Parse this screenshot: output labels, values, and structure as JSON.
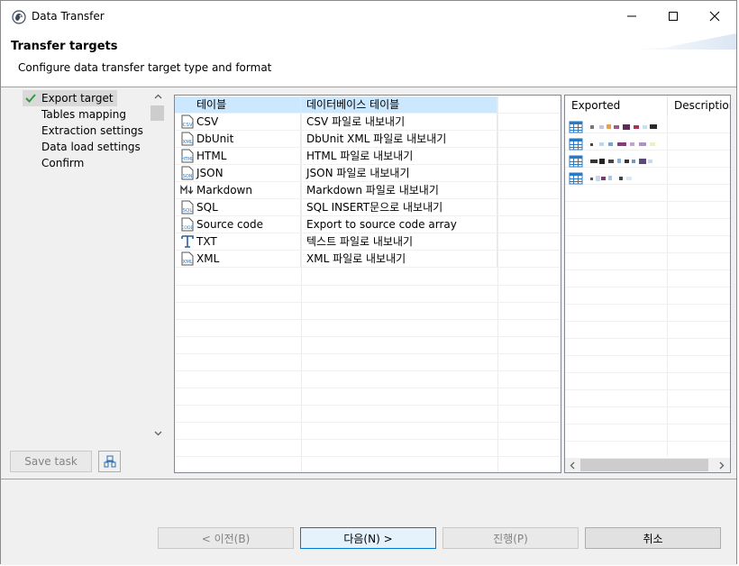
{
  "window": {
    "title": "Data Transfer",
    "accent": "#0078d7"
  },
  "header": {
    "title": "Transfer targets",
    "description": "Configure data transfer target type and format"
  },
  "nav": {
    "items": [
      {
        "label": "Export target",
        "selected": true,
        "icon": "check-icon"
      },
      {
        "label": "Tables mapping"
      },
      {
        "label": "Extraction settings"
      },
      {
        "label": "Data load settings"
      },
      {
        "label": "Confirm"
      }
    ],
    "save_task_label": "Save task"
  },
  "targets": [
    {
      "name": "테이블",
      "description": "데이터베이스 테이블",
      "icon": "table-icon",
      "selected": true
    },
    {
      "name": "CSV",
      "description": "CSV 파일로 내보내기",
      "icon": "csv-icon"
    },
    {
      "name": "DbUnit",
      "description": "DbUnit XML 파일로 내보내기",
      "icon": "xml-icon"
    },
    {
      "name": "HTML",
      "description": "HTML 파일로 내보내기",
      "icon": "html-icon"
    },
    {
      "name": "JSON",
      "description": "JSON 파일로 내보내기",
      "icon": "json-icon"
    },
    {
      "name": "Markdown",
      "description": "Markdown 파일로 내보내기",
      "icon": "markdown-icon"
    },
    {
      "name": "SQL",
      "description": "SQL INSERT문으로 내보내기",
      "icon": "sql-icon"
    },
    {
      "name": "Source code",
      "description": "Export to source code array",
      "icon": "code-icon"
    },
    {
      "name": "TXT",
      "description": "텍스트 파일로 내보내기",
      "icon": "text-icon"
    },
    {
      "name": "XML",
      "description": "XML 파일로 내보내기",
      "icon": "xml-icon"
    }
  ],
  "exported_panel": {
    "columns": [
      "Exported",
      "Description"
    ],
    "row_count": 4,
    "icon": "table-icon"
  },
  "buttons": {
    "back": "< 이전(B)",
    "next": "다음(N) >",
    "proceed": "진행(P)",
    "cancel": "취소"
  }
}
